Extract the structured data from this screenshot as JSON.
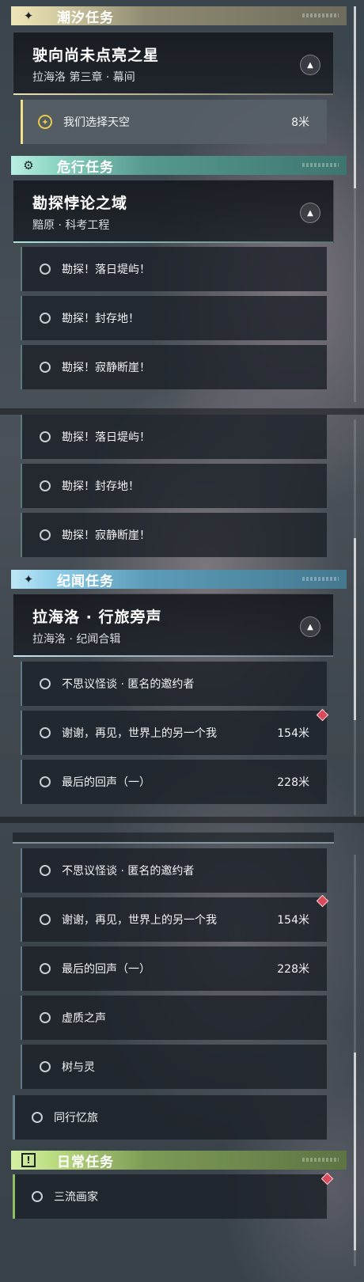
{
  "categories": {
    "tide": {
      "title": "潮汐任务",
      "icon": "star-icon"
    },
    "danger": {
      "title": "危行任务",
      "icon": "gear-icon"
    },
    "story": {
      "title": "纪闻任务",
      "icon": "star-icon"
    },
    "daily": {
      "title": "日常任务",
      "icon": "exclamation-icon"
    }
  },
  "tide_quest": {
    "title": "驶向尚未点亮之星",
    "subtitle": "拉海洛 第三章 · 幕间",
    "toggle": "▲"
  },
  "tide_tasks": [
    {
      "label": "我们选择天空",
      "distance": "8米"
    }
  ],
  "danger_quest": {
    "title": "勘探悖论之域",
    "subtitle": "黯原 · 科考工程",
    "toggle": "▲"
  },
  "danger_tasks": [
    {
      "label": "勘探！落日堤屿！"
    },
    {
      "label": "勘探！封存地！"
    },
    {
      "label": "勘探！寂静断崖！"
    }
  ],
  "story_quest": {
    "title": "拉海洛 · 行旅旁声",
    "subtitle": "拉海洛 · 纪闻合辑",
    "toggle": "▲"
  },
  "story_tasks": [
    {
      "label": "不思议怪谈 · 匿名的邀约者",
      "distance": ""
    },
    {
      "label": "谢谢，再见，世界上的另一个我",
      "distance": "154米"
    },
    {
      "label": "最后的回声（一）",
      "distance": "228米"
    },
    {
      "label": "虚质之声",
      "distance": ""
    },
    {
      "label": "树与灵",
      "distance": ""
    }
  ],
  "misc_tasks": [
    {
      "label": "同行忆旅"
    }
  ],
  "daily_tasks": [
    {
      "label": "三流画家"
    }
  ],
  "colors": {
    "tide": "#efe5b8",
    "danger": "#a9e6d7",
    "story": "#bde6f5",
    "daily": "#d5f0a4",
    "marker": "#d94a5c"
  }
}
